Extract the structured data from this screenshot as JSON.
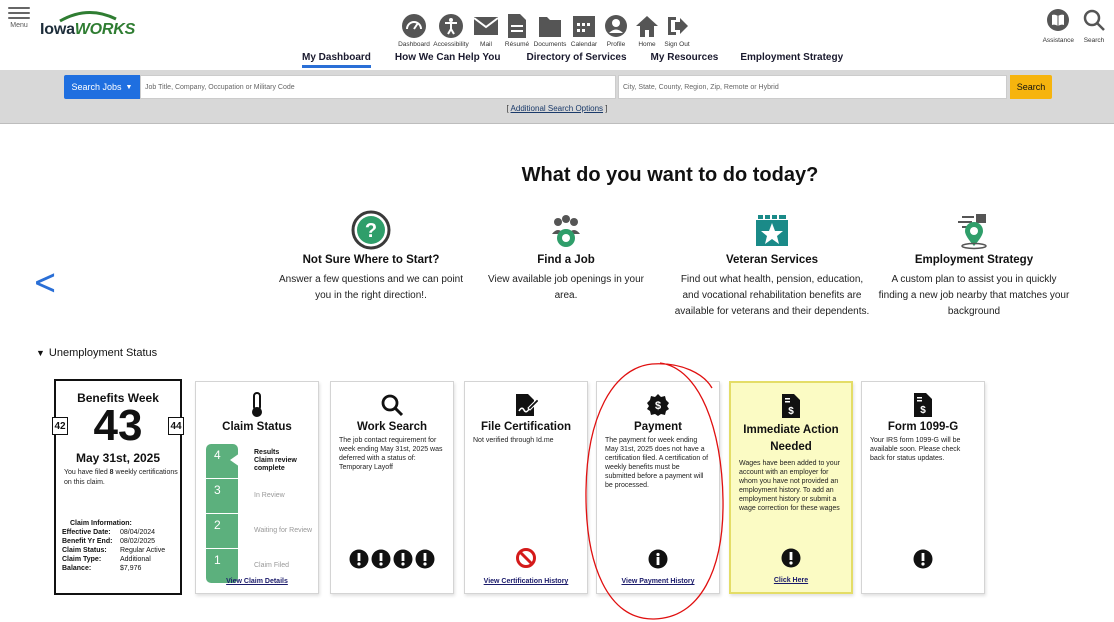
{
  "header": {
    "menu_label": "Menu",
    "logo_prefix": "Iowa",
    "logo_suffix": "WORKS",
    "icon_nav": [
      {
        "label": "Dashboard",
        "icon": "dashboard-gauge-icon"
      },
      {
        "label": "Accessibility",
        "icon": "accessibility-icon"
      },
      {
        "label": "Mail",
        "icon": "mail-icon"
      },
      {
        "label": "Résumé",
        "icon": "resume-icon"
      },
      {
        "label": "Documents",
        "icon": "folder-icon"
      },
      {
        "label": "Calendar",
        "icon": "calendar-icon"
      },
      {
        "label": "Profile",
        "icon": "profile-icon"
      },
      {
        "label": "Home",
        "icon": "home-icon"
      },
      {
        "label": "Sign Out",
        "icon": "sign-out-icon"
      }
    ],
    "text_nav": [
      "My Dashboard",
      "How We Can Help You",
      "Directory of Services",
      "My Resources",
      "Employment Strategy"
    ],
    "assistance_label": "Assistance",
    "search_label": "Search"
  },
  "search": {
    "jobs_button": "Search Jobs",
    "jobs_placeholder": "Job Title, Company, Occupation or Military Code",
    "location_placeholder": "City, State, County, Region, Zip, Remote or Hybrid",
    "search_button": "Search",
    "additional_prefix": "[ ",
    "additional_link": "Additional Search Options",
    "additional_suffix": " ]"
  },
  "main": {
    "title": "What do you want to do today?",
    "options": [
      {
        "title": "Not Sure Where to Start?",
        "desc": "Answer a few questions and we can point you in the right direction!."
      },
      {
        "title": "Find a Job",
        "desc": "View available job openings in your area."
      },
      {
        "title": "Veteran Services",
        "desc": "Find out what health, pension, education, and vocational rehabilitation benefits are available for veterans and their dependents."
      },
      {
        "title": "Employment Strategy",
        "desc": "A custom plan to assist you in quickly finding a new job nearby that matches your background"
      }
    ],
    "section_label": "Unemployment Status"
  },
  "benefits": {
    "title": "Benefits Week",
    "prev_week": "42",
    "week": "43",
    "next_week": "44",
    "date": "May 31st, 2025",
    "filed_prefix": "You have filed ",
    "filed_count": "8",
    "filed_suffix": " weekly certifications on this claim.",
    "info_heading": "Claim Information:",
    "info": [
      {
        "k": "Effective Date:",
        "v": "08/04/2024"
      },
      {
        "k": "Benefit Yr End:",
        "v": "08/02/2025"
      },
      {
        "k": "Claim Status:",
        "v": "Regular Active"
      },
      {
        "k": "Claim Type:",
        "v": "Additional"
      },
      {
        "k": "Balance:",
        "v": "$7,976"
      }
    ]
  },
  "claim_status": {
    "title": "Claim Status",
    "steps": [
      "4",
      "3",
      "2",
      "1"
    ],
    "step_labels": [
      "Results",
      "In Review",
      "Waiting for Review",
      "Claim Filed"
    ],
    "step4_sub": "Claim review complete",
    "link": "View Claim Details"
  },
  "work_search": {
    "title": "Work Search",
    "body": "The job contact requirement for week ending May 31st, 2025 was deferred with a status of: Temporary Layoff",
    "alert_count": 4
  },
  "file_cert": {
    "title": "File Certification",
    "body": "Not verified through Id.me",
    "link": "View Certification History"
  },
  "payment": {
    "title": "Payment",
    "body": "The payment for week ending May 31st, 2025 does not have a certification filed. A certification of weekly benefits must be submitted before a payment will be processed.",
    "link": "View Payment History"
  },
  "immediate": {
    "title": "Immediate Action Needed",
    "body": "Wages have been added to your account with an employer for whom you have not provided an employment history. To add an employment history or submit a wage correction for these wages",
    "link": "Click Here"
  },
  "form1099": {
    "title": "Form 1099-G",
    "body": "Your IRS form 1099-G will be available soon. Please check back for status updates."
  },
  "colors": {
    "accent_blue": "#1f6fe0",
    "search_yellow": "#f6b40e",
    "step_green": "#5cb07d",
    "annotation_red": "#e01010"
  }
}
